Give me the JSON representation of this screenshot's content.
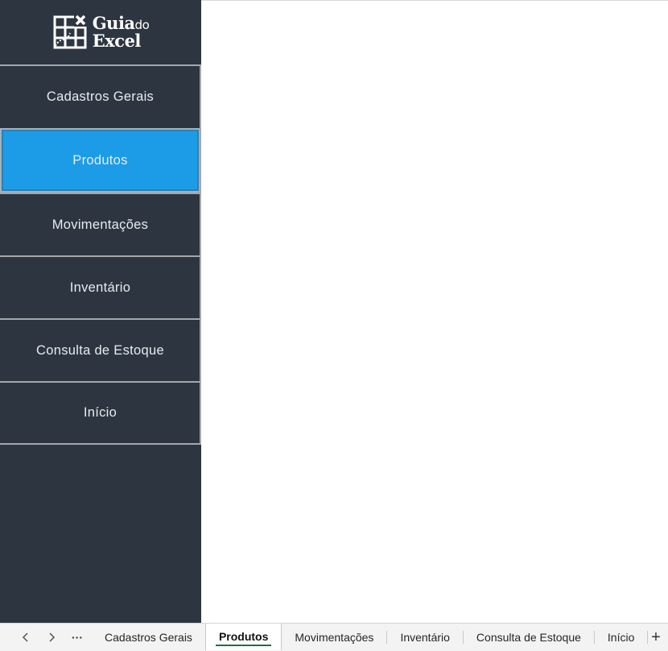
{
  "logo": {
    "line1_bold": "Guia",
    "line1_small": "do",
    "line2": "Excel"
  },
  "sidebar": {
    "items": [
      {
        "label": "Cadastros Gerais",
        "active": false
      },
      {
        "label": "Produtos",
        "active": true
      },
      {
        "label": "Movimentações",
        "active": false
      },
      {
        "label": "Inventário",
        "active": false
      },
      {
        "label": "Consulta de Estoque",
        "active": false
      },
      {
        "label": "Início",
        "active": false
      }
    ]
  },
  "tabbar": {
    "more_label": "···",
    "add_label": "+",
    "tabs": [
      {
        "label": "Cadastros Gerais"
      },
      {
        "label": "Produtos"
      },
      {
        "label": "Movimentações"
      },
      {
        "label": "Inventário"
      },
      {
        "label": "Consulta de Estoque"
      },
      {
        "label": "Início"
      }
    ],
    "active_tab": "Produtos"
  },
  "colors": {
    "sidebar_bg": "#2d3540",
    "active_bg": "#1c9ce6",
    "divider": "#a3a8ad",
    "tab_underline": "#1f6e43"
  }
}
